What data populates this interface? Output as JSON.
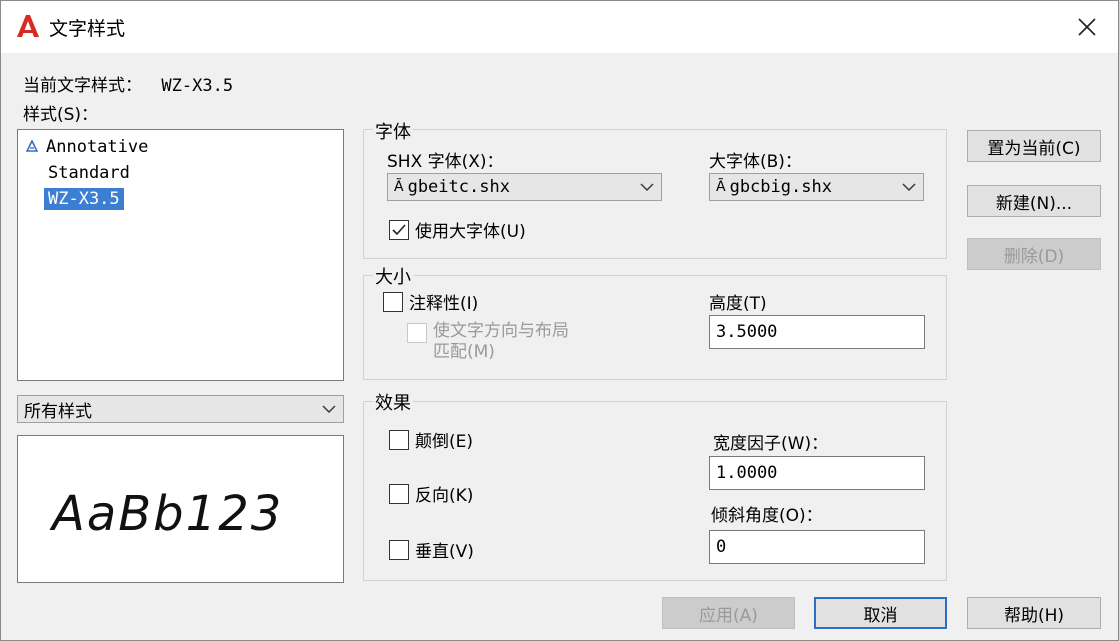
{
  "window": {
    "title": "文字样式",
    "close_label": "✕"
  },
  "current_style": {
    "label": "当前文字样式：",
    "value": "WZ-X3.5"
  },
  "styles_panel": {
    "label": "样式(S)：",
    "items": [
      {
        "name": "Annotative",
        "icon": "annotative-icon"
      },
      {
        "name": "Standard",
        "icon": ""
      },
      {
        "name": "WZ-X3.5",
        "icon": "",
        "selected": true
      }
    ],
    "filter_value": "所有样式"
  },
  "preview": {
    "text": "AaBb123"
  },
  "font_group": {
    "title": "字体",
    "shx_label": "SHX 字体(X)：",
    "shx_value": "gbeitc.shx",
    "big_label": "大字体(B)：",
    "big_value": "gbcbig.shx",
    "use_big_font_label": "使用大字体(U)",
    "use_big_font_checked": true
  },
  "size_group": {
    "title": "大小",
    "annotative_label": "注释性(I)",
    "annotative_checked": false,
    "match_orientation_line1": "使文字方向与布局",
    "match_orientation_line2": "匹配(M)",
    "height_label": "高度(T)",
    "height_value": "3.5000"
  },
  "effects_group": {
    "title": "效果",
    "upside_down_label": "颠倒(E)",
    "backwards_label": "反向(K)",
    "vertical_label": "垂直(V)",
    "width_factor_label": "宽度因子(W)：",
    "width_factor_value": "1.0000",
    "oblique_label": "倾斜角度(O)：",
    "oblique_value": "0"
  },
  "side_buttons": {
    "set_current": "置为当前(C)",
    "new": "新建(N)...",
    "delete": "删除(D)"
  },
  "bottom_buttons": {
    "apply": "应用(A)",
    "cancel": "取消",
    "help": "帮助(H)"
  },
  "colors": {
    "accent": "#2d6fc4",
    "selection": "#3c7fd2",
    "logo_red": "#d62a22"
  }
}
